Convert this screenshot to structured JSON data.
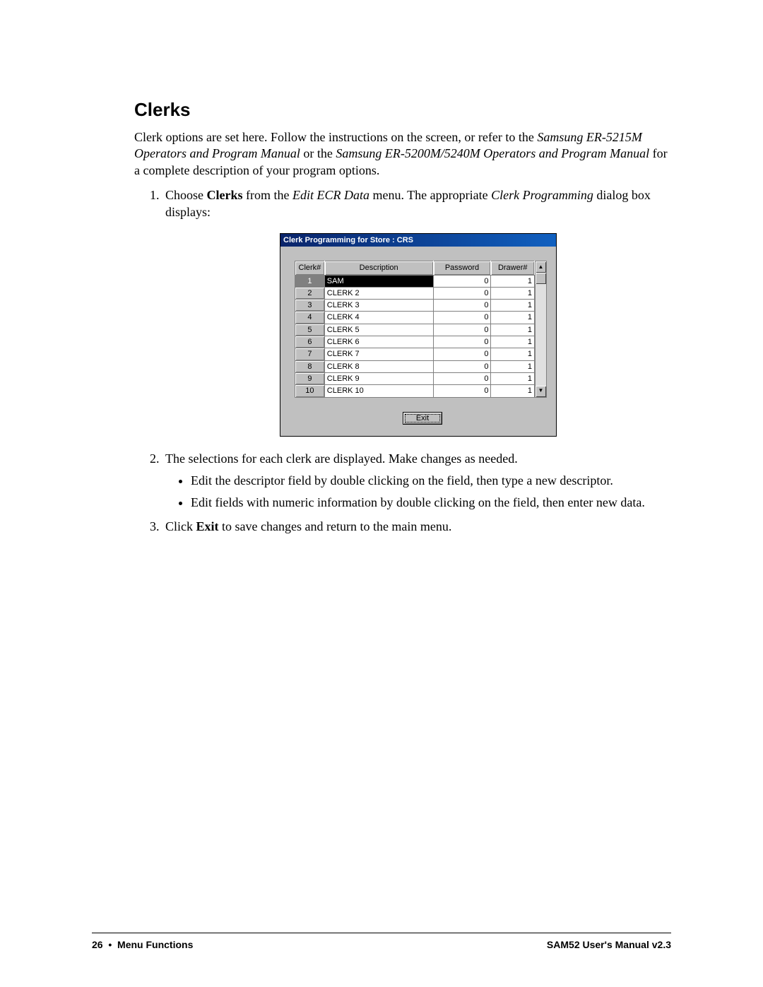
{
  "heading": "Clerks",
  "intro": {
    "t1": "Clerk options are set here.  Follow the instructions on the screen, or refer to the ",
    "m1": "Samsung ER-5215M Operators and Program Manual",
    "t2": " or the ",
    "m2": "Samsung ER-5200M/5240M Operators and Program Manual",
    "t3": " for a complete description of your program options."
  },
  "step1": {
    "a": "Choose ",
    "b": "Clerks",
    "c": " from the ",
    "d": "Edit ECR Data",
    "e": " menu.  The appropriate ",
    "f": "Clerk Programming",
    "g": " dialog box displays:"
  },
  "dialog": {
    "title": "Clerk Programming for Store :   CRS",
    "columns": {
      "clerk": "Clerk#",
      "desc": "Description",
      "pwd": "Password",
      "drw": "Drawer#"
    },
    "rows": [
      {
        "n": "1",
        "desc": "SAM",
        "pwd": "0",
        "drw": "1",
        "selected": true
      },
      {
        "n": "2",
        "desc": "CLERK 2",
        "pwd": "0",
        "drw": "1"
      },
      {
        "n": "3",
        "desc": "CLERK 3",
        "pwd": "0",
        "drw": "1"
      },
      {
        "n": "4",
        "desc": "CLERK 4",
        "pwd": "0",
        "drw": "1"
      },
      {
        "n": "5",
        "desc": "CLERK 5",
        "pwd": "0",
        "drw": "1"
      },
      {
        "n": "6",
        "desc": "CLERK 6",
        "pwd": "0",
        "drw": "1"
      },
      {
        "n": "7",
        "desc": "CLERK 7",
        "pwd": "0",
        "drw": "1"
      },
      {
        "n": "8",
        "desc": "CLERK 8",
        "pwd": "0",
        "drw": "1"
      },
      {
        "n": "9",
        "desc": "CLERK 9",
        "pwd": "0",
        "drw": "1"
      },
      {
        "n": "10",
        "desc": "CLERK 10",
        "pwd": "0",
        "drw": "1"
      }
    ],
    "exit": "Exit"
  },
  "step2": "The selections for each clerk are displayed.  Make changes as needed.",
  "step2_bullets": [
    "Edit the descriptor field by double clicking on the field, then type a new descriptor.",
    "Edit fields with numeric information by double clicking on the field, then enter new data."
  ],
  "step3": {
    "a": "Click ",
    "b": "Exit",
    "c": " to save changes and return to the main menu."
  },
  "footer": {
    "left_page": "26",
    "left_bullet": "•",
    "left_section": "Menu Functions",
    "right": "SAM52 User's Manual v2.3"
  }
}
